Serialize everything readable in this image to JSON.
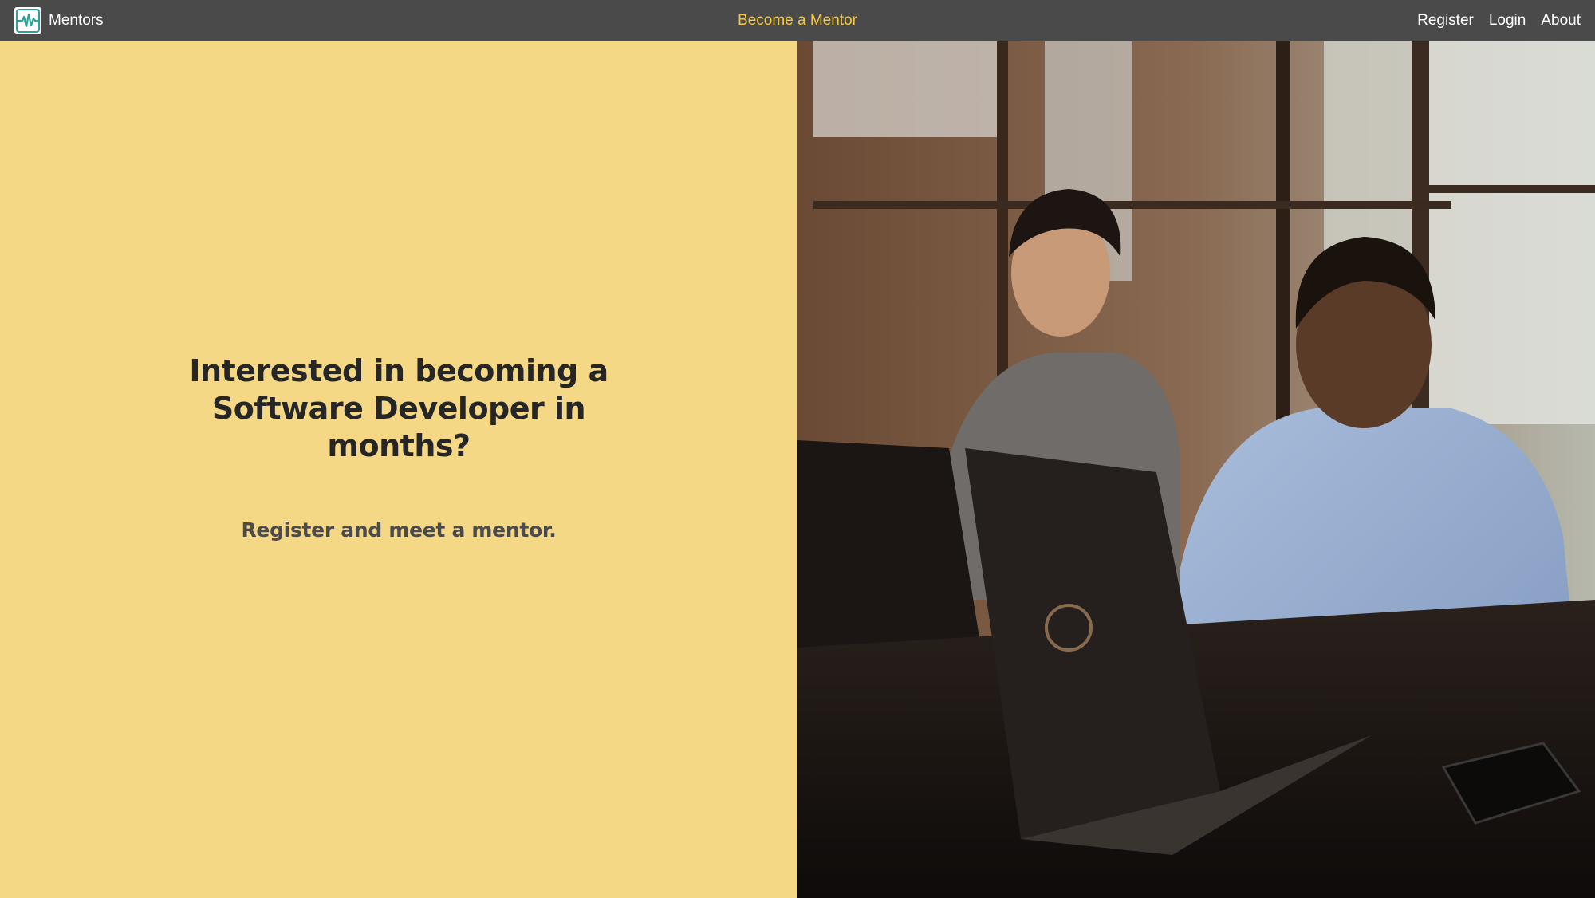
{
  "navbar": {
    "brand": {
      "logo_icon": "heartbeat-logo-icon",
      "name": "Mentors"
    },
    "center_link": "Become a Mentor",
    "links": [
      "Register",
      "Login",
      "About"
    ],
    "accent_color": "#f5c842",
    "background": "#4a4a4a"
  },
  "hero": {
    "title_lines": [
      "Interested in becoming a",
      "Software Developer in",
      "months?"
    ],
    "subtitle": "Register and meet a mentor.",
    "background": "#f5d886",
    "photo_icon": "mentoring-photo"
  }
}
